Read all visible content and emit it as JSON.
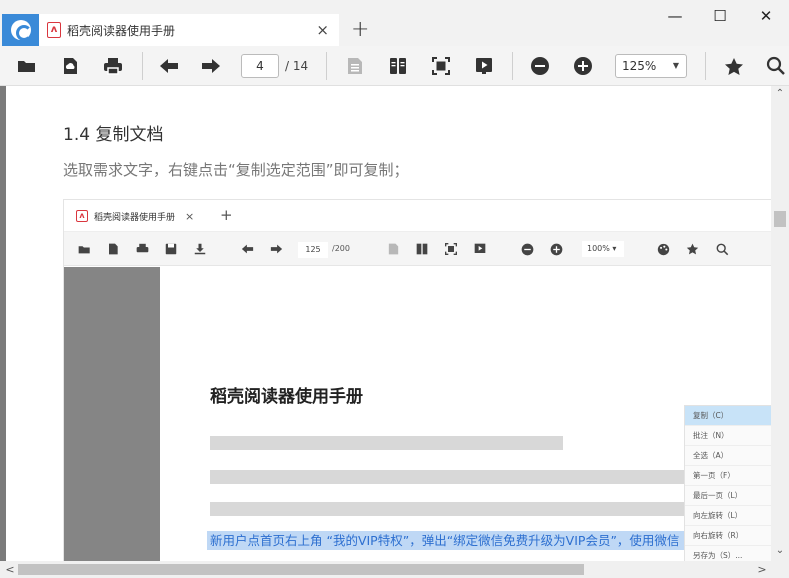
{
  "window": {
    "tab_title": "稻壳阅读器使用手册",
    "tab_close": "×",
    "new_tab": "+",
    "minimize": "—",
    "maximize": "☐",
    "close": "✕"
  },
  "toolbar": {
    "current_page": "4",
    "total_pages": "/ 14",
    "zoom": "125%",
    "icons": [
      "folder-open-icon",
      "cloud-icon",
      "print-icon",
      "arrow-left-icon",
      "arrow-right-icon",
      "document-icon",
      "two-page-icon",
      "fit-page-icon",
      "play-icon",
      "zoom-out-icon",
      "zoom-in-icon",
      "star-icon",
      "search-icon"
    ]
  },
  "document": {
    "heading": "1.4 复制文档",
    "description": "选取需求文字，右键点击“复制选定范围”即可复制；"
  },
  "embedded_screenshot": {
    "tab_title": "稻壳阅读器使用手册",
    "tab_close": "×",
    "new_tab": "+",
    "current_page": "125",
    "total_pages": "/200",
    "zoom": "100% ▾",
    "page_title": "稻壳阅读器使用手册",
    "selected_text": "新用户点首页右上角 “我的VIP特权”，弹出“绑定微信免费升级为VIP会员”，使用微信",
    "context_menu": [
      "复制（C）",
      "批注（N）",
      "全选（A）",
      "第一页（F）",
      "最后一页（L）",
      "向左旋转（L）",
      "向右旋转（R）",
      "另存为（S）..."
    ]
  },
  "colors": {
    "accent": "#3a8ad8",
    "pdf_red": "#d9363e",
    "selection": "#bfd8f5",
    "context_active": "#c8e3f8"
  }
}
